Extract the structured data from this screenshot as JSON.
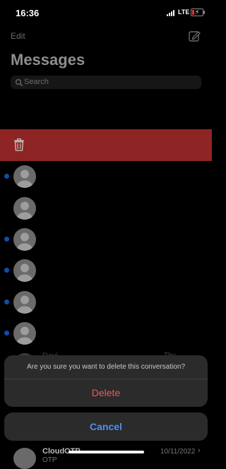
{
  "status_bar": {
    "time": "16:36",
    "network": "LTE",
    "battery_level": 0.15,
    "battery_color": "#e33333",
    "signal_icon": "cellular-signal-icon",
    "battery_icon": "battery-charging-icon"
  },
  "nav": {
    "edit_label": "Edit",
    "compose_icon": "compose-icon"
  },
  "title": "Messages",
  "search": {
    "placeholder": "Search",
    "icon": "search-icon"
  },
  "swipe_action": {
    "icon": "trash-icon",
    "color": "#8e2424"
  },
  "conversations": [
    {
      "unread": true
    },
    {
      "unread": false
    },
    {
      "unread": true
    },
    {
      "unread": true
    },
    {
      "unread": true
    },
    {
      "unread": true
    }
  ],
  "partially_hidden_conversation": {
    "name_fragment": "Davi",
    "date_fragment": "Thu"
  },
  "action_sheet": {
    "message": "Are you sure you want to delete this conversation?",
    "delete_label": "Delete",
    "cancel_label": "Cancel",
    "delete_color": "#f0584f",
    "cancel_color": "#4f8ef2"
  },
  "bottom_conversation": {
    "name": "CloudOTP",
    "preview": "OTP",
    "date": "10/11/2022",
    "chevron": "›"
  },
  "colors": {
    "unread_dot": "#0a4fb0",
    "background": "#000000"
  }
}
